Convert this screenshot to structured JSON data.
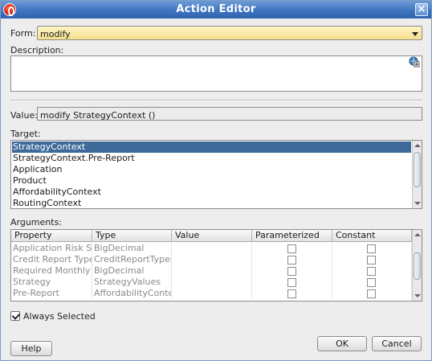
{
  "window": {
    "title": "Action Editor"
  },
  "form": {
    "label": "Form:",
    "value": "modify"
  },
  "description": {
    "label": "Description:",
    "value": ""
  },
  "value_field": {
    "label": "Value:",
    "value": "modify StrategyContext ()"
  },
  "target": {
    "label": "Target:",
    "items": [
      {
        "label": "StrategyContext",
        "selected": true
      },
      {
        "label": "StrategyContext.Pre-Report",
        "selected": false
      },
      {
        "label": "Application",
        "selected": false
      },
      {
        "label": "Product",
        "selected": false
      },
      {
        "label": "AffordabilityContext",
        "selected": false
      },
      {
        "label": "RoutingContext",
        "selected": false
      }
    ]
  },
  "arguments": {
    "label": "Arguments:",
    "columns": [
      "Property",
      "Type",
      "Value",
      "Parameterized",
      "Constant"
    ],
    "rows": [
      {
        "property": "Application Risk S...",
        "type": "BigDecimal",
        "value": "",
        "parameterized": false,
        "constant": false
      },
      {
        "property": "Credit Report Type",
        "type": "CreditReportTypes",
        "value": "",
        "parameterized": false,
        "constant": false
      },
      {
        "property": "Required Monthly ...",
        "type": "BigDecimal",
        "value": "",
        "parameterized": false,
        "constant": false
      },
      {
        "property": "Strategy",
        "type": "StrategyValues",
        "value": "",
        "parameterized": false,
        "constant": false
      },
      {
        "property": "Pre-Report",
        "type": "AffordabilityConte...",
        "value": "",
        "parameterized": false,
        "constant": false
      }
    ]
  },
  "always_selected": {
    "label": "Always Selected",
    "checked": true
  },
  "buttons": {
    "help": "Help",
    "ok": "OK",
    "cancel": "Cancel"
  },
  "icons": {
    "app": "oracle-app-icon",
    "close": "close-icon",
    "description_edit": "edit-globe-icon"
  },
  "colors": {
    "titlebar": "#3f74c0",
    "selection": "#3e6a9a",
    "combo": "#f6e08c"
  }
}
